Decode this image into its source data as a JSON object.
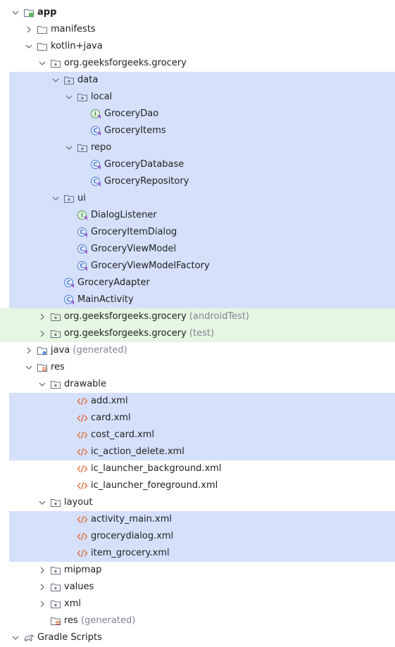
{
  "tree": [
    {
      "label": "app",
      "icon": "module",
      "chevron": "open",
      "depth": 0,
      "bold": true
    },
    {
      "label": "manifests",
      "icon": "folder",
      "chevron": "closed",
      "depth": 1
    },
    {
      "label": "kotlin+java",
      "icon": "folder",
      "chevron": "open",
      "depth": 1
    },
    {
      "label": "org.geeksforgeeks.grocery",
      "icon": "package",
      "chevron": "open",
      "depth": 2
    },
    {
      "label": "data",
      "icon": "package",
      "chevron": "open",
      "depth": 3,
      "bg": "selected"
    },
    {
      "label": "local",
      "icon": "package",
      "chevron": "open",
      "depth": 4,
      "bg": "selected"
    },
    {
      "label": "GroceryDao",
      "icon": "interface",
      "depth": 5,
      "bg": "selected"
    },
    {
      "label": "GroceryItems",
      "icon": "class",
      "depth": 5,
      "bg": "selected"
    },
    {
      "label": "repo",
      "icon": "package",
      "chevron": "open",
      "depth": 4,
      "bg": "selected"
    },
    {
      "label": "GroceryDatabase",
      "icon": "class",
      "depth": 5,
      "bg": "selected"
    },
    {
      "label": "GroceryRepository",
      "icon": "class",
      "depth": 5,
      "bg": "selected"
    },
    {
      "label": "ui",
      "icon": "package",
      "chevron": "open",
      "depth": 3,
      "bg": "selected"
    },
    {
      "label": "DialogListener",
      "icon": "interface",
      "depth": 4,
      "bg": "selected"
    },
    {
      "label": "GroceryItemDialog",
      "icon": "class",
      "depth": 4,
      "bg": "selected"
    },
    {
      "label": "GroceryViewModel",
      "icon": "class",
      "depth": 4,
      "bg": "selected"
    },
    {
      "label": "GroceryViewModelFactory",
      "icon": "class",
      "depth": 4,
      "bg": "selected"
    },
    {
      "label": "GroceryAdapter",
      "icon": "class",
      "depth": 3,
      "bg": "selected"
    },
    {
      "label": "MainActivity",
      "icon": "class",
      "depth": 3,
      "bg": "selected"
    },
    {
      "label": "org.geeksforgeeks.grocery",
      "suffix": "(androidTest)",
      "icon": "package",
      "chevron": "closed",
      "depth": 2,
      "bg": "test"
    },
    {
      "label": "org.geeksforgeeks.grocery",
      "suffix": "(test)",
      "icon": "package",
      "chevron": "closed",
      "depth": 2,
      "bg": "test"
    },
    {
      "label": "java",
      "suffix": "(generated)",
      "icon": "generated-folder",
      "chevron": "closed",
      "depth": 1
    },
    {
      "label": "res",
      "icon": "resource-folder",
      "chevron": "open",
      "depth": 1
    },
    {
      "label": "drawable",
      "icon": "package",
      "chevron": "open",
      "depth": 2
    },
    {
      "label": "add.xml",
      "icon": "xml-file",
      "depth": 4,
      "bg": "selected"
    },
    {
      "label": "card.xml",
      "icon": "xml-file",
      "depth": 4,
      "bg": "selected"
    },
    {
      "label": "cost_card.xml",
      "icon": "xml-file",
      "depth": 4,
      "bg": "selected"
    },
    {
      "label": "ic_action_delete.xml",
      "icon": "xml-file",
      "depth": 4,
      "bg": "selected"
    },
    {
      "label": "ic_launcher_background.xml",
      "icon": "xml-file",
      "depth": 4
    },
    {
      "label": "ic_launcher_foreground.xml",
      "icon": "xml-file",
      "depth": 4
    },
    {
      "label": "layout",
      "icon": "package",
      "chevron": "open",
      "depth": 2
    },
    {
      "label": "activity_main.xml",
      "icon": "xml-file",
      "depth": 4,
      "bg": "selected"
    },
    {
      "label": "grocerydialog.xml",
      "icon": "xml-file",
      "depth": 4,
      "bg": "selected"
    },
    {
      "label": "item_grocery.xml",
      "icon": "xml-file",
      "depth": 4,
      "bg": "selected"
    },
    {
      "label": "mipmap",
      "icon": "package",
      "chevron": "closed",
      "depth": 2
    },
    {
      "label": "values",
      "icon": "package",
      "chevron": "closed",
      "depth": 2
    },
    {
      "label": "xml",
      "icon": "package",
      "chevron": "closed",
      "depth": 2
    },
    {
      "label": "res",
      "suffix": "(generated)",
      "icon": "resource-folder",
      "depth": 2
    },
    {
      "label": "Gradle Scripts",
      "icon": "gradle-icon",
      "chevron": "open",
      "depth": 0
    }
  ],
  "colors": {
    "selected_bg": "#d5e0fb",
    "test_bg": "#e5f6e2",
    "suffix_text": "#818594",
    "xml_icon": "#e0642d",
    "class_icon": "#4a7ad6",
    "interface_icon": "#4a9b4a"
  }
}
